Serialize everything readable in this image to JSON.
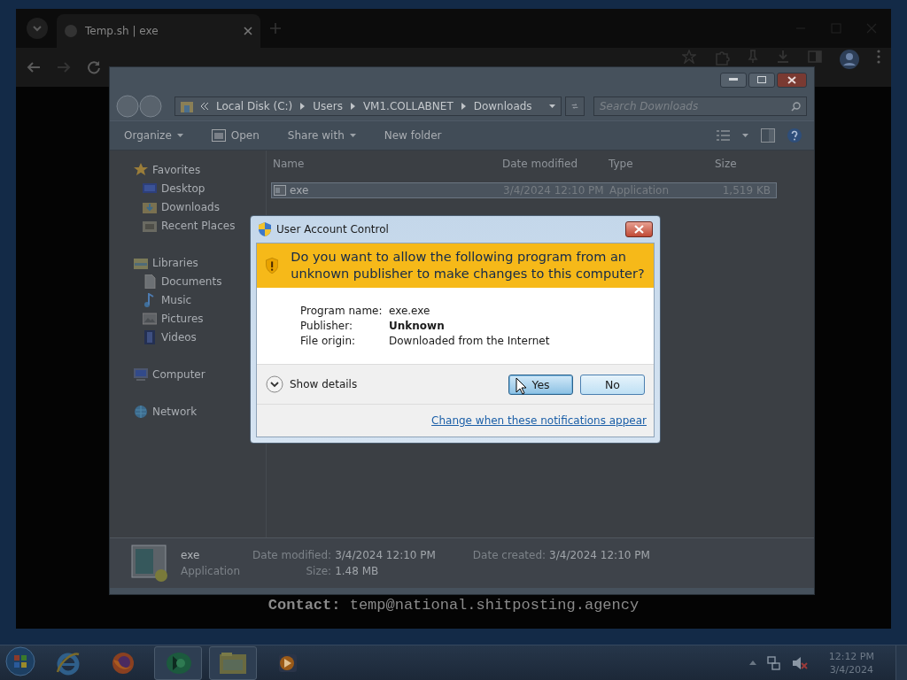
{
  "browser": {
    "tab": {
      "title": "Temp.sh | exe"
    },
    "page_text": "**Contact:** temp@national.shitposting.agency"
  },
  "explorer": {
    "breadcrumb": [
      "Local Disk (C:)",
      "Users",
      "VM1.COLLABNET",
      "Downloads"
    ],
    "search": {
      "placeholder": "Search Downloads"
    },
    "toolbar": [
      {
        "label": "Organize",
        "kind": "menu"
      },
      {
        "label": "Open",
        "kind": "icon"
      },
      {
        "label": "Share with",
        "kind": "menu"
      },
      {
        "label": "New folder",
        "kind": "plain"
      }
    ],
    "nav": [
      {
        "label": "Favorites",
        "kind": "star",
        "children": [
          {
            "label": "Desktop",
            "kind": "desktop"
          },
          {
            "label": "Downloads",
            "kind": "downloads"
          },
          {
            "label": "Recent Places",
            "kind": "recent"
          }
        ]
      },
      {
        "label": "Libraries",
        "kind": "library",
        "children": [
          {
            "label": "Documents",
            "kind": "document"
          },
          {
            "label": "Music",
            "kind": "music"
          },
          {
            "label": "Pictures",
            "kind": "pictures"
          },
          {
            "label": "Videos",
            "kind": "videos"
          }
        ]
      },
      {
        "label": "Computer",
        "kind": "computer",
        "selected": false
      },
      {
        "label": "Network",
        "kind": "network",
        "selected": false
      }
    ],
    "columns": [
      "Name",
      "Date modified",
      "Type",
      "Size"
    ],
    "rows": [
      {
        "name": "exe",
        "date": "3/4/2024 12:10 PM",
        "type": "Application",
        "size": "1,519 KB",
        "selected": true
      }
    ],
    "details": {
      "name": "exe",
      "type": "Application",
      "fields": [
        {
          "label": "Date modified:",
          "value": "3/4/2024 12:10 PM"
        },
        {
          "label": "Date created:",
          "value": "3/4/2024 12:10 PM"
        },
        {
          "label": "Size:",
          "value": "1.48 MB"
        }
      ]
    }
  },
  "uac": {
    "title": "User Account Control",
    "question": "Do you want to allow the following program from an unknown publisher to make changes to this computer?",
    "info": [
      {
        "label": "Program name:",
        "value": "exe.exe",
        "bold": false
      },
      {
        "label": "Publisher:",
        "value": "Unknown",
        "bold": true
      },
      {
        "label": "File origin:",
        "value": "Downloaded from the Internet",
        "bold": false
      }
    ],
    "details_toggle": "Show details",
    "buttons": [
      {
        "label": "Yes",
        "focused": true
      },
      {
        "label": "No",
        "focused": false
      }
    ],
    "link": "Change when these notifications appear"
  },
  "taskbar": {
    "apps": [
      {
        "kind": "ie",
        "active": false
      },
      {
        "kind": "firefox",
        "active": false
      },
      {
        "kind": "greenapp",
        "active": true
      },
      {
        "kind": "explorer",
        "active": true
      },
      {
        "kind": "media",
        "active": false
      }
    ],
    "clock": {
      "time": "12:12 PM",
      "date": "3/4/2024"
    }
  }
}
